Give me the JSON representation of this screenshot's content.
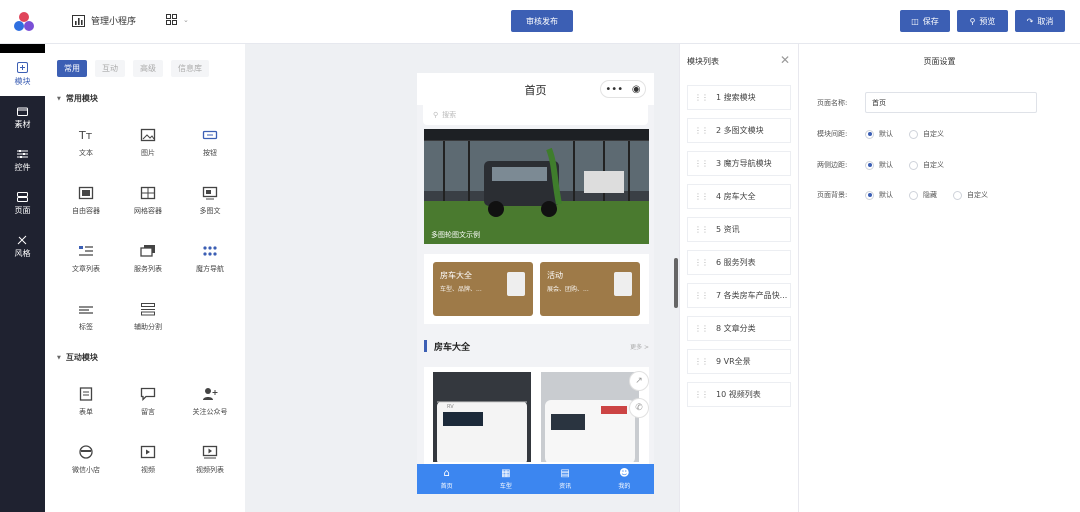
{
  "header": {
    "app_name": "管理小程序",
    "grid_icon": "grid-icon",
    "review_publish": "审核发布",
    "save": "保存",
    "preview": "预览",
    "cancel": "取消"
  },
  "rail": {
    "items": [
      {
        "label": "模块",
        "icon": "plus-square-icon"
      },
      {
        "label": "素材",
        "icon": "folder-icon"
      },
      {
        "label": "控件",
        "icon": "sliders-icon"
      },
      {
        "label": "页面",
        "icon": "layers-icon"
      },
      {
        "label": "风格",
        "icon": "brush-icon"
      }
    ]
  },
  "components": {
    "tabs": [
      "常用",
      "互动",
      "高级",
      "信息库"
    ],
    "common_title": "常用模块",
    "common_items": [
      "文本",
      "图片",
      "按钮",
      "自由容器",
      "网格容器",
      "多图文",
      "文章列表",
      "服务列表",
      "魔方导航",
      "标签",
      "辅助分割"
    ],
    "interactive_title": "互动模块",
    "interactive_items": [
      "表单",
      "留言",
      "关注公众号",
      "微信小店",
      "视频",
      "视频列表"
    ]
  },
  "phone": {
    "title": "首页",
    "search_placeholder": "搜索",
    "banner_caption": "多图轮图文示例",
    "nav_cards": [
      {
        "title": "房车大全",
        "sub": "车型、品牌、..."
      },
      {
        "title": "活动",
        "sub": "展会、团购、..."
      }
    ],
    "section_title": "房车大全",
    "more": "更多 >",
    "tabbar": [
      "首页",
      "车型",
      "资讯",
      "我的"
    ]
  },
  "module_list": {
    "title": "模块列表",
    "items": [
      "1 搜索模块",
      "2 多图文模块",
      "3 魔方导航模块",
      "4 房车大全",
      "5 资讯",
      "6 服务列表",
      "7 各类房车产品快...",
      "8 文章分类",
      "9 VR全景",
      "10 视频列表"
    ]
  },
  "page_settings": {
    "title": "页面设置",
    "name_label": "页面名称:",
    "name_value": "首页",
    "spacing_label": "模块间距:",
    "spacing_options": [
      "默认",
      "自定义"
    ],
    "margin_label": "两侧边距:",
    "margin_options": [
      "默认",
      "自定义"
    ],
    "bg_label": "页面背景:",
    "bg_options": [
      "默认",
      "隐藏",
      "自定义"
    ]
  },
  "colors": {
    "accent": "#3c5fb4",
    "tabbar": "#3c86f0",
    "card": "#9e7a48",
    "rail": "#1f2230"
  }
}
